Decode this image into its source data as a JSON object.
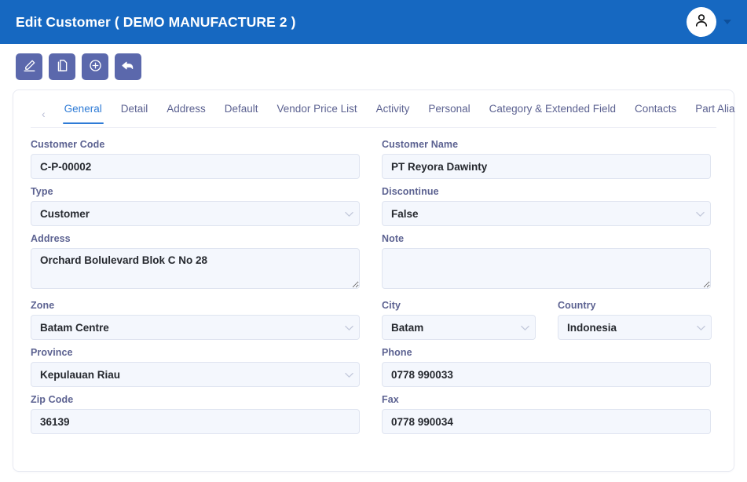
{
  "header": {
    "title": "Edit Customer ( DEMO MANUFACTURE 2 )",
    "background_color": "#1668c1",
    "avatar_icon": "user-icon",
    "caret_icon": "chevron-down-icon"
  },
  "toolbar": {
    "button_color": "#5b68ac",
    "buttons": [
      {
        "name": "edit",
        "icon": "pencil-icon"
      },
      {
        "name": "copy",
        "icon": "copy-icon"
      },
      {
        "name": "add",
        "icon": "plus-circle-icon"
      },
      {
        "name": "back",
        "icon": "undo-arrow-icon"
      }
    ]
  },
  "tabs": {
    "prev_icon": "chevron-left-icon",
    "next_icon": "chevron-right-icon",
    "active_color": "#2e7bd6",
    "items": [
      {
        "label": "General",
        "active": true
      },
      {
        "label": "Detail",
        "active": false
      },
      {
        "label": "Address",
        "active": false
      },
      {
        "label": "Default",
        "active": false
      },
      {
        "label": "Vendor Price List",
        "active": false
      },
      {
        "label": "Activity",
        "active": false
      },
      {
        "label": "Personal",
        "active": false
      },
      {
        "label": "Category & Extended Field",
        "active": false
      },
      {
        "label": "Contacts",
        "active": false
      },
      {
        "label": "Part Alia",
        "active": false
      }
    ]
  },
  "form": {
    "customer_code": {
      "label": "Customer Code",
      "value": "C-P-00002"
    },
    "customer_name": {
      "label": "Customer Name",
      "value": "PT Reyora Dawinty"
    },
    "type": {
      "label": "Type",
      "value": "Customer"
    },
    "discontinue": {
      "label": "Discontinue",
      "value": "False"
    },
    "address": {
      "label": "Address",
      "value": "Orchard Bolulevard Blok C No 28"
    },
    "note": {
      "label": "Note",
      "value": ""
    },
    "zone": {
      "label": "Zone",
      "value": "Batam Centre"
    },
    "city": {
      "label": "City",
      "value": "Batam"
    },
    "country": {
      "label": "Country",
      "value": "Indonesia"
    },
    "province": {
      "label": "Province",
      "value": "Kepulauan Riau"
    },
    "phone": {
      "label": "Phone",
      "value": "0778 990033"
    },
    "zip_code": {
      "label": "Zip Code",
      "value": "36139"
    },
    "fax": {
      "label": "Fax",
      "value": "0778 990034"
    }
  }
}
